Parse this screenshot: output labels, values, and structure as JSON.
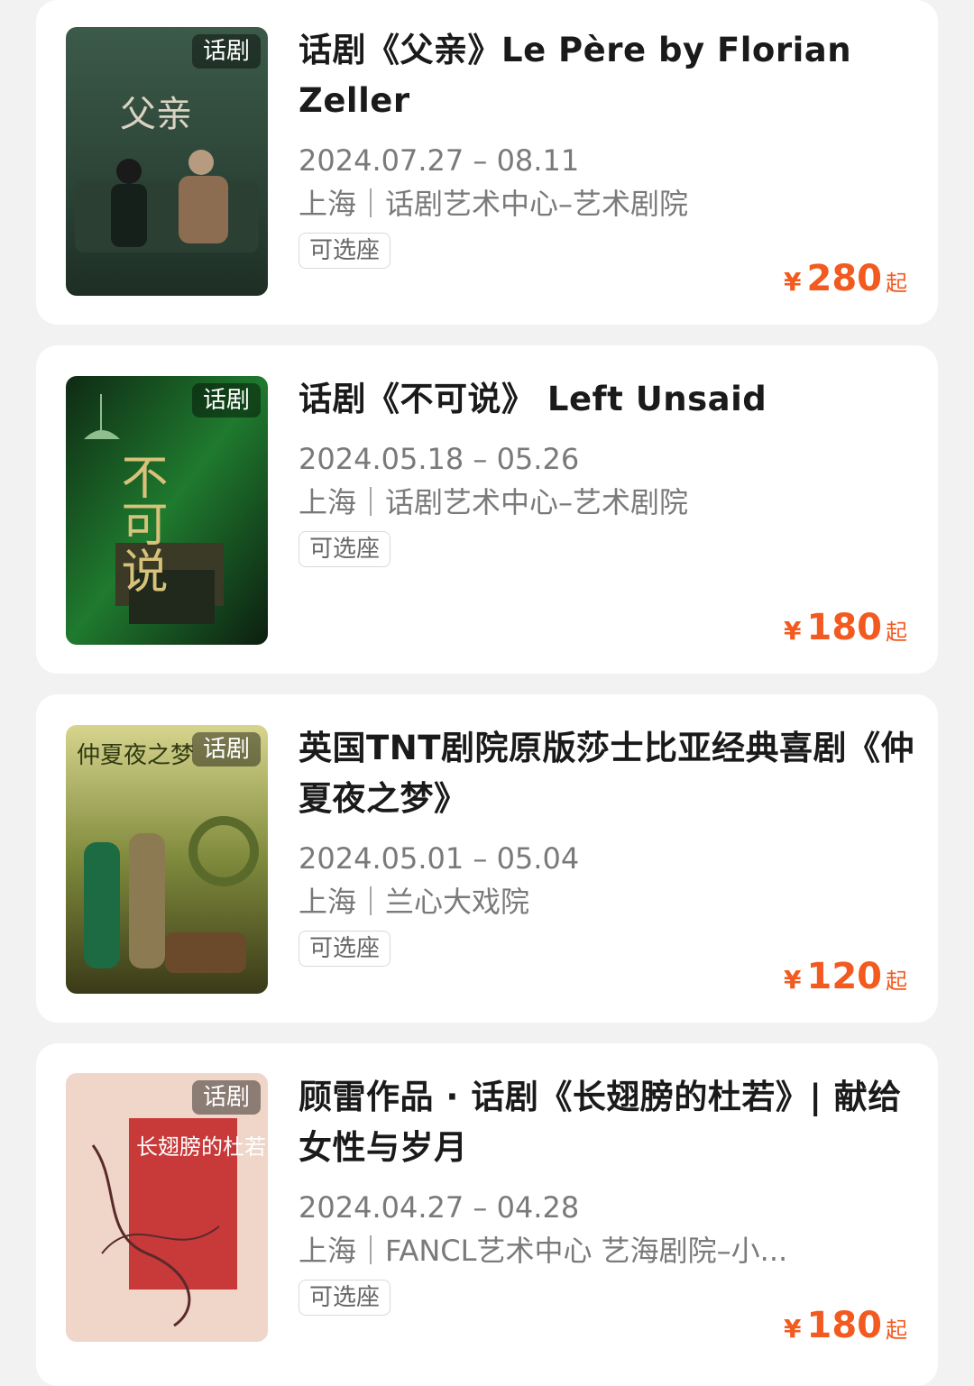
{
  "items": [
    {
      "tag": "话剧",
      "title": "话剧《父亲》Le Père by Florian Zeller",
      "date": "2024.07.27 – 08.11",
      "venue": "上海｜话剧艺术中心–艺术剧院",
      "seat": "可选座",
      "currency": "¥",
      "price": "280",
      "price_suffix": "起",
      "poster_text": "父亲"
    },
    {
      "tag": "话剧",
      "title": "话剧《不可说》 Left Unsaid",
      "date": "2024.05.18 – 05.26",
      "venue": "上海｜话剧艺术中心–艺术剧院",
      "seat": "可选座",
      "currency": "¥",
      "price": "180",
      "price_suffix": "起",
      "poster_text": "不可说"
    },
    {
      "tag": "话剧",
      "title": "英国TNT剧院原版莎士比亚经典喜剧《仲夏夜之梦》",
      "date": "2024.05.01 – 05.04",
      "venue": "上海｜兰心大戏院",
      "seat": "可选座",
      "currency": "¥",
      "price": "120",
      "price_suffix": "起",
      "poster_text": "仲夏夜之梦"
    },
    {
      "tag": "话剧",
      "title": "顾雷作品 · 话剧《长翅膀的杜若》| 献给女性与岁月",
      "date": "2024.04.27 – 04.28",
      "venue": "上海｜FANCL艺术中心 艺海剧院–小...",
      "seat": "可选座",
      "currency": "¥",
      "price": "180",
      "price_suffix": "起",
      "poster_text": "长翅膀的杜若"
    }
  ],
  "colors": {
    "price": "#f25a1f",
    "background": "#f2f2f2",
    "card": "#ffffff"
  }
}
